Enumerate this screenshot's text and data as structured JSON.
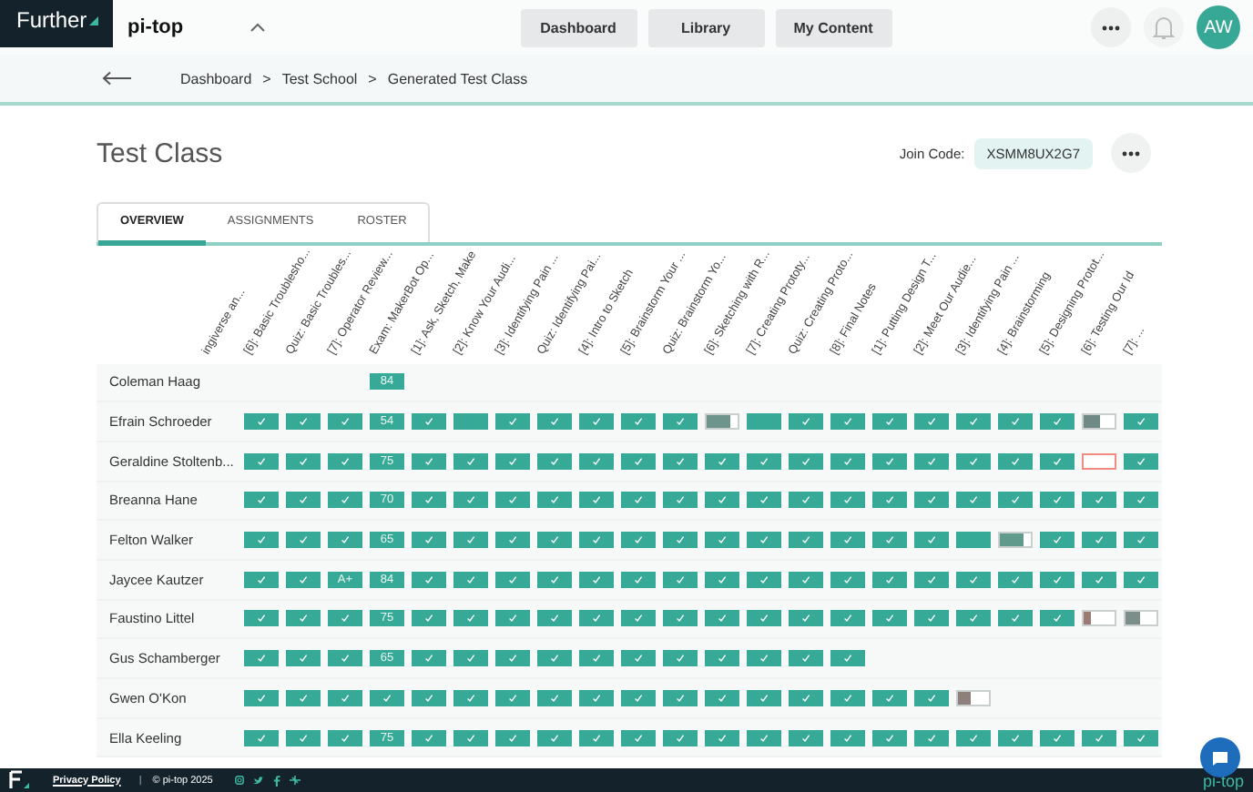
{
  "header": {
    "brand": "Further",
    "product": "pi-top",
    "nav": [
      {
        "label": "Dashboard"
      },
      {
        "label": "Library"
      },
      {
        "label": "My Content"
      }
    ],
    "avatar": "AW"
  },
  "breadcrumb": {
    "separator": ">",
    "items": [
      "Dashboard",
      "Test School",
      "Generated Test Class"
    ]
  },
  "page": {
    "title": "Test Class",
    "join_code_label": "Join Code:",
    "join_code": "XSMM8UX2G7"
  },
  "tabs": [
    {
      "label": "OVERVIEW",
      "selected": true
    },
    {
      "label": "ASSIGNMENTS",
      "selected": false
    },
    {
      "label": "ROSTER",
      "selected": false
    }
  ],
  "grid": {
    "cut_column": "ingiverse an...",
    "columns": [
      "[6]: Basic Troublesho...",
      "Quiz: Basic Troubles...",
      "[7]: Operator Review...",
      "Exam: MakerBot Op...",
      "[1]: Ask, Sketch, Make",
      "[2]: Know Your Audi...",
      "[3]: Identifying Pain ...",
      "Quiz: Identifying Pai...",
      "[4]: Intro to Sketch",
      "[5]: Brainstorm Your ...",
      "Quiz: Brainstorm Yo...",
      "[6]: Sketching with R...",
      "[7]: Creating Prototy...",
      "Quiz: Creating Proto...",
      "[8]: Final Notes",
      "[1]: Putting Design T...",
      "[2]: Meet Our Audie...",
      "[3]: Identifying Pain ...",
      "[4]: Brainstorming",
      "[5]: Designing Protot...",
      "[6]: Testing Our Id",
      "[7]: ..."
    ],
    "rows": [
      {
        "name": "Coleman Haag",
        "cells": [
          {
            "kind": "none"
          },
          {
            "kind": "none"
          },
          {
            "kind": "none"
          },
          {
            "kind": "score",
            "text": "84"
          },
          {
            "kind": "none"
          },
          {
            "kind": "none"
          },
          {
            "kind": "none"
          },
          {
            "kind": "none"
          },
          {
            "kind": "none"
          },
          {
            "kind": "none"
          },
          {
            "kind": "none"
          },
          {
            "kind": "none"
          },
          {
            "kind": "none"
          },
          {
            "kind": "none"
          },
          {
            "kind": "none"
          },
          {
            "kind": "none"
          },
          {
            "kind": "none"
          },
          {
            "kind": "none"
          },
          {
            "kind": "none"
          },
          {
            "kind": "none"
          },
          {
            "kind": "none"
          },
          {
            "kind": "none"
          }
        ]
      },
      {
        "name": "Efrain Schroeder",
        "cells": [
          {
            "kind": "done"
          },
          {
            "kind": "done"
          },
          {
            "kind": "done"
          },
          {
            "kind": "score",
            "text": "54"
          },
          {
            "kind": "done"
          },
          {
            "kind": "submitted"
          },
          {
            "kind": "done"
          },
          {
            "kind": "done"
          },
          {
            "kind": "done"
          },
          {
            "kind": "done"
          },
          {
            "kind": "done"
          },
          {
            "kind": "partial",
            "level": 0.75,
            "color": "#6e958b"
          },
          {
            "kind": "submitted"
          },
          {
            "kind": "done"
          },
          {
            "kind": "done"
          },
          {
            "kind": "done"
          },
          {
            "kind": "done"
          },
          {
            "kind": "done"
          },
          {
            "kind": "done"
          },
          {
            "kind": "done"
          },
          {
            "kind": "partial",
            "level": 0.55,
            "color": "#6f8a84"
          },
          {
            "kind": "done"
          }
        ]
      },
      {
        "name": "Geraldine Stoltenb...",
        "cells": [
          {
            "kind": "done"
          },
          {
            "kind": "done"
          },
          {
            "kind": "done"
          },
          {
            "kind": "score",
            "text": "75"
          },
          {
            "kind": "done"
          },
          {
            "kind": "done"
          },
          {
            "kind": "done"
          },
          {
            "kind": "done"
          },
          {
            "kind": "done"
          },
          {
            "kind": "done"
          },
          {
            "kind": "done"
          },
          {
            "kind": "done"
          },
          {
            "kind": "done"
          },
          {
            "kind": "done"
          },
          {
            "kind": "done"
          },
          {
            "kind": "done"
          },
          {
            "kind": "done"
          },
          {
            "kind": "done"
          },
          {
            "kind": "done"
          },
          {
            "kind": "done"
          },
          {
            "kind": "overdue"
          },
          {
            "kind": "done"
          }
        ]
      },
      {
        "name": "Breanna Hane",
        "cells": [
          {
            "kind": "done"
          },
          {
            "kind": "done"
          },
          {
            "kind": "done"
          },
          {
            "kind": "score",
            "text": "70"
          },
          {
            "kind": "done"
          },
          {
            "kind": "done"
          },
          {
            "kind": "done"
          },
          {
            "kind": "done"
          },
          {
            "kind": "done"
          },
          {
            "kind": "done"
          },
          {
            "kind": "done"
          },
          {
            "kind": "done"
          },
          {
            "kind": "done"
          },
          {
            "kind": "done"
          },
          {
            "kind": "done"
          },
          {
            "kind": "done"
          },
          {
            "kind": "done"
          },
          {
            "kind": "done"
          },
          {
            "kind": "done"
          },
          {
            "kind": "done"
          },
          {
            "kind": "done"
          },
          {
            "kind": "done"
          }
        ]
      },
      {
        "name": "Felton Walker",
        "cells": [
          {
            "kind": "done"
          },
          {
            "kind": "done"
          },
          {
            "kind": "done"
          },
          {
            "kind": "score",
            "text": "65"
          },
          {
            "kind": "done"
          },
          {
            "kind": "done"
          },
          {
            "kind": "done"
          },
          {
            "kind": "done"
          },
          {
            "kind": "done"
          },
          {
            "kind": "done"
          },
          {
            "kind": "done"
          },
          {
            "kind": "done"
          },
          {
            "kind": "done"
          },
          {
            "kind": "done"
          },
          {
            "kind": "done"
          },
          {
            "kind": "done"
          },
          {
            "kind": "done"
          },
          {
            "kind": "submitted"
          },
          {
            "kind": "partial",
            "level": 0.75,
            "color": "#5f9a8d"
          },
          {
            "kind": "done"
          },
          {
            "kind": "done"
          },
          {
            "kind": "done"
          }
        ]
      },
      {
        "name": "Jaycee Kautzer",
        "cells": [
          {
            "kind": "done"
          },
          {
            "kind": "done"
          },
          {
            "kind": "score",
            "text": "A+"
          },
          {
            "kind": "score",
            "text": "84"
          },
          {
            "kind": "done"
          },
          {
            "kind": "done"
          },
          {
            "kind": "done"
          },
          {
            "kind": "done"
          },
          {
            "kind": "done"
          },
          {
            "kind": "done"
          },
          {
            "kind": "done"
          },
          {
            "kind": "done"
          },
          {
            "kind": "done"
          },
          {
            "kind": "done"
          },
          {
            "kind": "done"
          },
          {
            "kind": "done"
          },
          {
            "kind": "done"
          },
          {
            "kind": "done"
          },
          {
            "kind": "done"
          },
          {
            "kind": "done"
          },
          {
            "kind": "done"
          },
          {
            "kind": "done"
          }
        ]
      },
      {
        "name": "Faustino Littel",
        "cells": [
          {
            "kind": "done"
          },
          {
            "kind": "done"
          },
          {
            "kind": "done"
          },
          {
            "kind": "score",
            "text": "75"
          },
          {
            "kind": "done"
          },
          {
            "kind": "done"
          },
          {
            "kind": "done"
          },
          {
            "kind": "done"
          },
          {
            "kind": "done"
          },
          {
            "kind": "done"
          },
          {
            "kind": "done"
          },
          {
            "kind": "done"
          },
          {
            "kind": "done"
          },
          {
            "kind": "done"
          },
          {
            "kind": "done"
          },
          {
            "kind": "done"
          },
          {
            "kind": "done"
          },
          {
            "kind": "done"
          },
          {
            "kind": "done"
          },
          {
            "kind": "done"
          },
          {
            "kind": "partial",
            "level": 0.25,
            "color": "#9a7a72"
          },
          {
            "kind": "partial",
            "level": 0.45,
            "color": "#7b8e89"
          }
        ]
      },
      {
        "name": "Gus Schamberger",
        "cells": [
          {
            "kind": "done"
          },
          {
            "kind": "done"
          },
          {
            "kind": "done"
          },
          {
            "kind": "score",
            "text": "65"
          },
          {
            "kind": "done"
          },
          {
            "kind": "done"
          },
          {
            "kind": "done"
          },
          {
            "kind": "done"
          },
          {
            "kind": "done"
          },
          {
            "kind": "done"
          },
          {
            "kind": "done"
          },
          {
            "kind": "done"
          },
          {
            "kind": "done"
          },
          {
            "kind": "done"
          },
          {
            "kind": "done"
          },
          {
            "kind": "none"
          },
          {
            "kind": "none"
          },
          {
            "kind": "none"
          },
          {
            "kind": "none"
          },
          {
            "kind": "none"
          },
          {
            "kind": "none"
          },
          {
            "kind": "none"
          }
        ]
      },
      {
        "name": "Gwen O'Kon",
        "cells": [
          {
            "kind": "done"
          },
          {
            "kind": "done"
          },
          {
            "kind": "done"
          },
          {
            "kind": "done"
          },
          {
            "kind": "done"
          },
          {
            "kind": "done"
          },
          {
            "kind": "done"
          },
          {
            "kind": "done"
          },
          {
            "kind": "done"
          },
          {
            "kind": "done"
          },
          {
            "kind": "done"
          },
          {
            "kind": "done"
          },
          {
            "kind": "done"
          },
          {
            "kind": "done"
          },
          {
            "kind": "done"
          },
          {
            "kind": "done"
          },
          {
            "kind": "done"
          },
          {
            "kind": "partial",
            "level": 0.4,
            "color": "#8c7f7c"
          },
          {
            "kind": "none"
          },
          {
            "kind": "none"
          },
          {
            "kind": "none"
          },
          {
            "kind": "none"
          }
        ]
      },
      {
        "name": "Ella Keeling",
        "cells": [
          {
            "kind": "done"
          },
          {
            "kind": "done"
          },
          {
            "kind": "done"
          },
          {
            "kind": "score",
            "text": "75"
          },
          {
            "kind": "done"
          },
          {
            "kind": "done"
          },
          {
            "kind": "done"
          },
          {
            "kind": "done"
          },
          {
            "kind": "done"
          },
          {
            "kind": "done"
          },
          {
            "kind": "done"
          },
          {
            "kind": "done"
          },
          {
            "kind": "done"
          },
          {
            "kind": "done"
          },
          {
            "kind": "done"
          },
          {
            "kind": "done"
          },
          {
            "kind": "done"
          },
          {
            "kind": "done"
          },
          {
            "kind": "done"
          },
          {
            "kind": "done"
          },
          {
            "kind": "done"
          },
          {
            "kind": "done"
          }
        ]
      }
    ]
  },
  "footer": {
    "link": "Privacy Policy",
    "separator": "|",
    "copyright": "© pi-top 2025",
    "brand": "pi-top"
  }
}
